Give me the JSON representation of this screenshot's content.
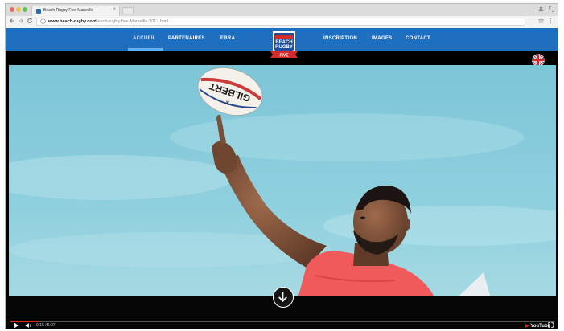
{
  "browser": {
    "tab_title": "Beach Rugby Five Marseille",
    "tab_close": "×",
    "url_domain": "www.beach-rugby.com",
    "url_path": "/beach-rugby-five-Marseille-2017.html"
  },
  "nav": {
    "items": [
      {
        "label": "ACCUEIL",
        "active": true
      },
      {
        "label": "PARTENAIRES",
        "active": false
      },
      {
        "label": "EBRA",
        "active": false
      },
      {
        "label": "INSCRIPTION",
        "active": false
      },
      {
        "label": "IMAGES",
        "active": false
      },
      {
        "label": "CONTACT",
        "active": false
      }
    ]
  },
  "logo": {
    "line1": "BEACH",
    "line2": "RUGBY",
    "line3": "FIVE"
  },
  "hero": {
    "ball_text": "GILBERT",
    "ball_letter": "X"
  },
  "video": {
    "time": "0:15 / 5:07",
    "progress": 0.05,
    "brand": "YouTube"
  },
  "colors": {
    "nav_bg": "#1f6fc0",
    "sky": "#88c9d8",
    "jersey": "#f05a5a",
    "progress": "#e62117"
  },
  "icons": {
    "scroll": "arrow-down-icon",
    "language": "uk-flag-icon",
    "play": "play-icon",
    "volume": "volume-icon",
    "fullscreen": "fullscreen-icon"
  }
}
